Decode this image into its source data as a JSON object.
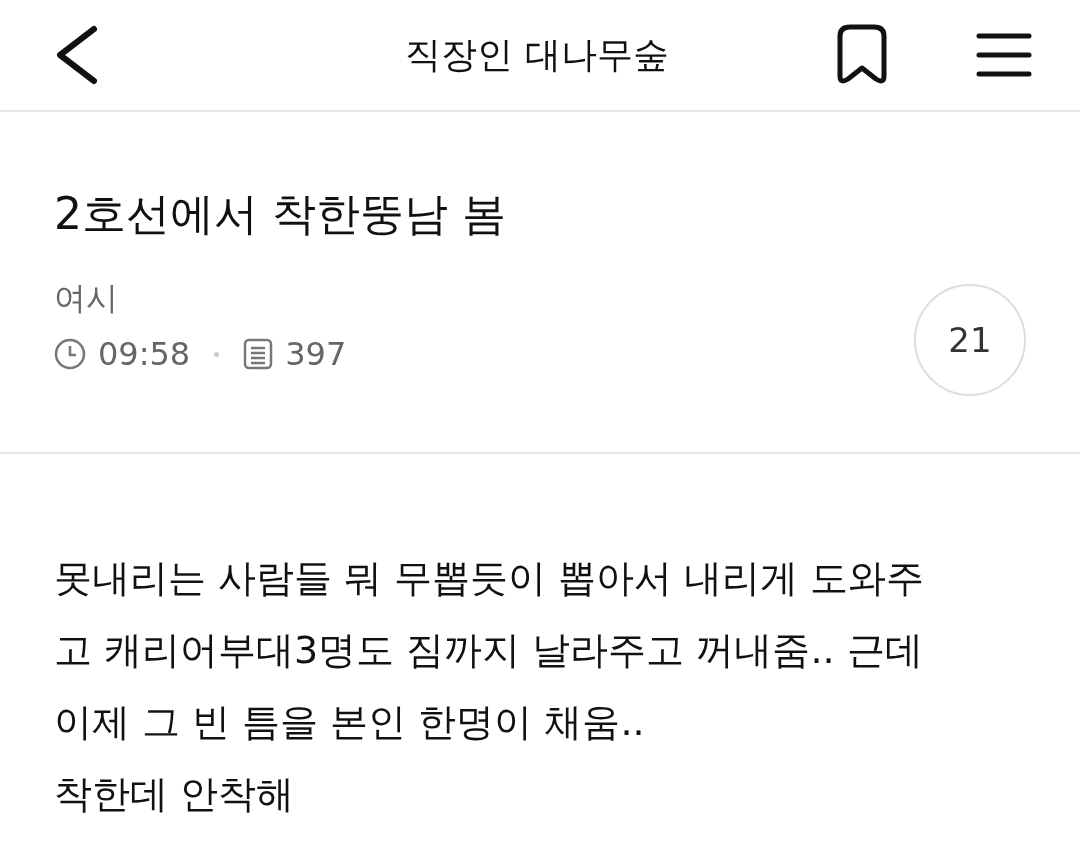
{
  "header": {
    "title": "직장인 대나무숲",
    "bookmarked": false
  },
  "post": {
    "title": "2호선에서 착한뚱남 봄",
    "author": "여시",
    "time": "09:58",
    "views": "397",
    "comments": "21",
    "body_lines": [
      "못내리는 사람들 뭐 무뽑듯이 뽑아서 내리게 도와주",
      "고 캐리어부대3명도 짐까지 날라주고 꺼내줌.. 근데",
      "이제 그 빈 틈을 본인 한명이 채움..",
      "착한데 안착해"
    ]
  }
}
